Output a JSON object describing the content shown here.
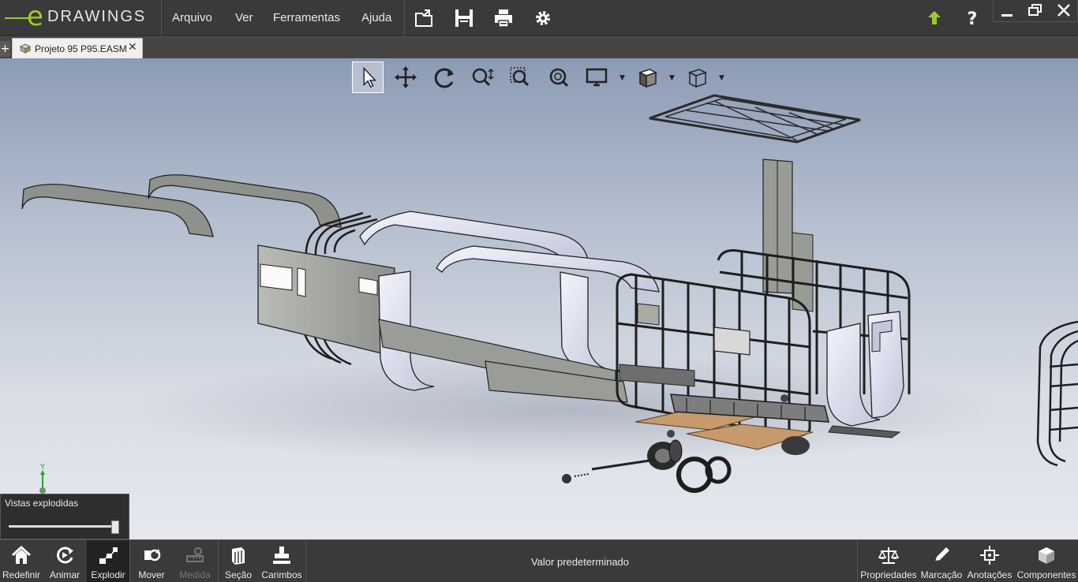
{
  "app": {
    "logo_text": "DRAWINGS",
    "logo_letter": "e",
    "logo_mark": "®"
  },
  "menu": {
    "items": [
      "Arquivo",
      "Ver",
      "Ferramentas",
      "Ajuda"
    ]
  },
  "toolbar_icons": [
    "open-icon",
    "save-icon",
    "print-icon",
    "settings-icon"
  ],
  "right_icons": [
    "update-icon",
    "help-icon"
  ],
  "window_controls": [
    "minimize-icon",
    "restore-icon",
    "close-icon"
  ],
  "tabs": {
    "add_label": "+",
    "document": {
      "label": "Projeto 95 P95.EASM",
      "close": "✕"
    }
  },
  "view_toolbar": [
    "select-icon",
    "pan-icon",
    "rotate-icon",
    "zoom-icon",
    "zoom-area-icon",
    "zoom-fit-icon",
    "display-style-icon",
    "shading-icon",
    "view-orientation-icon"
  ],
  "triad": {
    "axis_label": "Y"
  },
  "explode_panel": {
    "title": "Vistas explodidas",
    "slider_value": 1.0
  },
  "bottom_left": [
    {
      "label": "Redefinir",
      "icon": "home-icon",
      "enabled": true
    },
    {
      "label": "Animar",
      "icon": "animate-icon",
      "enabled": true
    },
    {
      "label": "Explodir",
      "icon": "explode-icon",
      "enabled": true,
      "active": true
    },
    {
      "label": "Mover",
      "icon": "move-icon",
      "enabled": true
    },
    {
      "label": "Medida",
      "icon": "measure-icon",
      "enabled": false
    },
    {
      "label": "Seção",
      "icon": "section-icon",
      "enabled": true
    },
    {
      "label": "Carimbos",
      "icon": "stamp-icon",
      "enabled": true
    }
  ],
  "status": {
    "text": "Valor predeterminado"
  },
  "bottom_right": [
    {
      "label": "Propriedades",
      "icon": "properties-icon"
    },
    {
      "label": "Marcação",
      "icon": "markup-icon"
    },
    {
      "label": "Anotações",
      "icon": "annotations-icon"
    },
    {
      "label": "Componentes",
      "icon": "components-icon"
    }
  ],
  "colors": {
    "accent": "#9ccc2c",
    "bar": "#3a3a3a",
    "viewport_top": "#8c9bb5",
    "viewport_bottom": "#e6e8ee"
  }
}
